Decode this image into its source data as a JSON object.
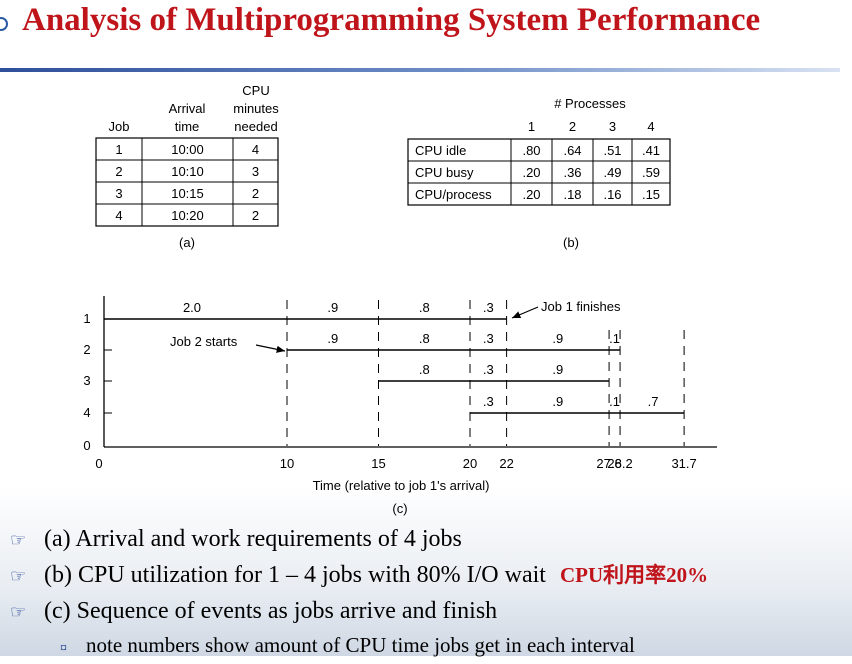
{
  "title": "Analysis of Multiprogramming System Performance",
  "table_a": {
    "header_col1": "Job",
    "header_col2": [
      "Arrival",
      "time"
    ],
    "header_col3": [
      "CPU",
      "minutes",
      "needed"
    ],
    "rows": [
      [
        "1",
        "10:00",
        "4"
      ],
      [
        "2",
        "10:10",
        "3"
      ],
      [
        "3",
        "10:15",
        "2"
      ],
      [
        "4",
        "10:20",
        "2"
      ]
    ],
    "caption": "(a)"
  },
  "table_b": {
    "header": "# Processes",
    "columns": [
      "1",
      "2",
      "3",
      "4"
    ],
    "rows": [
      {
        "label": "CPU idle",
        "values": [
          ".80",
          ".64",
          ".51",
          ".41"
        ]
      },
      {
        "label": "CPU busy",
        "values": [
          ".20",
          ".36",
          ".49",
          ".59"
        ]
      },
      {
        "label": "CPU/process",
        "values": [
          ".20",
          ".18",
          ".16",
          ".15"
        ]
      }
    ],
    "caption": "(b)"
  },
  "timeline": {
    "y_ticks": [
      "1",
      "2",
      "3",
      "4",
      "0"
    ],
    "x_ticks": [
      "0",
      "10",
      "15",
      "20",
      "22",
      "27.6",
      "28.2",
      "31.7"
    ],
    "x_values": [
      0,
      10,
      15,
      20,
      22,
      27.6,
      28.2,
      31.7
    ],
    "xlabel": "Time (relative to job 1's arrival)",
    "caption": "(c)",
    "job_bars": [
      {
        "job": 1,
        "start": 0,
        "end": 22
      },
      {
        "job": 2,
        "start": 10,
        "end": 28.2
      },
      {
        "job": 3,
        "start": 15,
        "end": 27.6
      },
      {
        "job": 4,
        "start": 20,
        "end": 31.7
      }
    ],
    "job_labels": [
      {
        "job": 1,
        "values": [
          "2.0",
          ".9",
          ".8",
          ".3"
        ]
      },
      {
        "job": 2,
        "values": [
          ".9",
          ".8",
          ".3",
          ".9",
          ".1"
        ]
      },
      {
        "job": 3,
        "values": [
          ".8",
          ".3",
          ".9"
        ]
      },
      {
        "job": 4,
        "values": [
          ".3",
          ".9",
          ".1",
          ".7"
        ]
      }
    ],
    "annotation_job1": "Job 1 finishes",
    "annotation_job2": "Job 2 starts"
  },
  "bullets": [
    {
      "text": "(a) Arrival and work requirements of 4 jobs",
      "icon": "pointing-hand-icon"
    },
    {
      "text": "(b) CPU utilization for 1 – 4 jobs with 80% I/O wait",
      "icon": "pointing-hand-icon",
      "highlight": "CPU利用率20%"
    },
    {
      "text": "(c) Sequence of events as jobs arrive and finish",
      "icon": "pointing-hand-icon"
    }
  ],
  "sub_bullet": {
    "text": "note numbers show amount of CPU time jobs get in each interval",
    "icon": "square-bullet-icon"
  },
  "colors": {
    "title": "#c0141b",
    "rule": "#2e4f9a",
    "highlight": "#c0141b"
  }
}
